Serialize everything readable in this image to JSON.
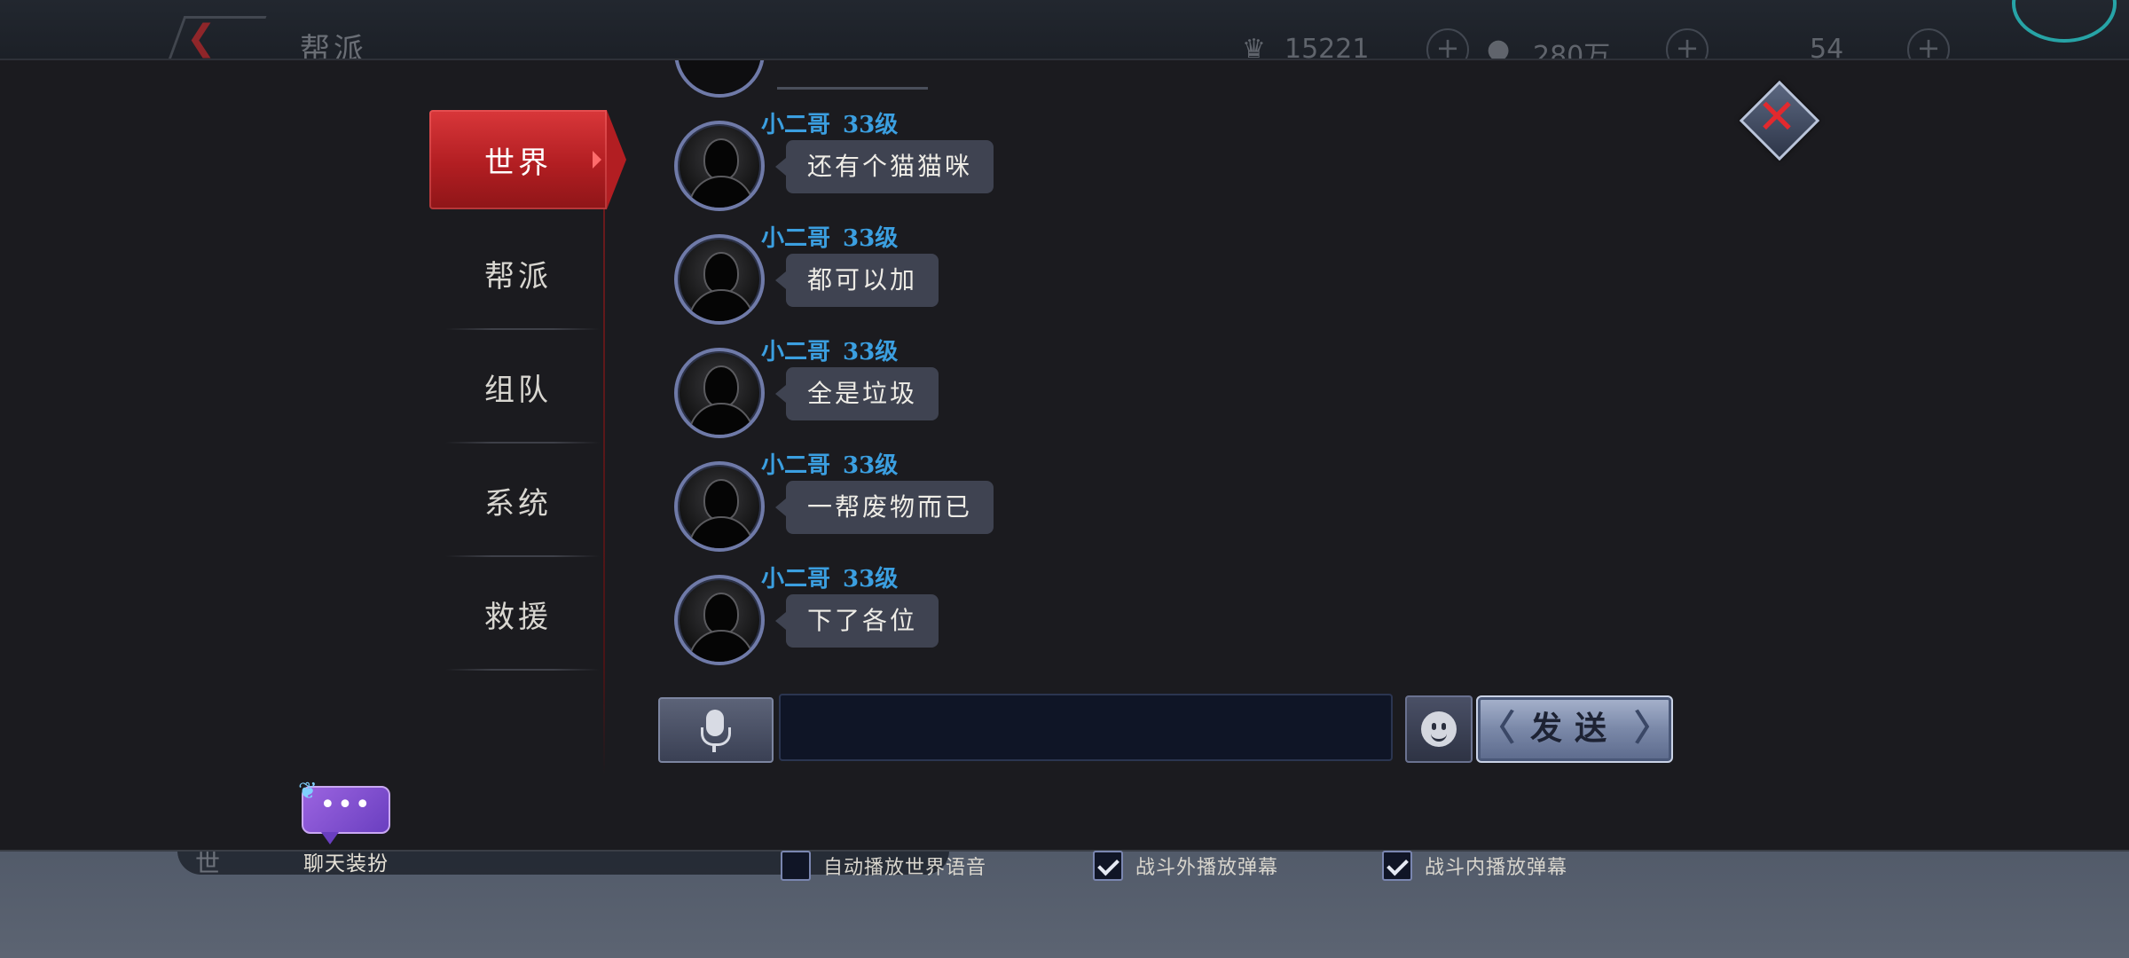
{
  "background": {
    "title": "帮派",
    "resources": [
      {
        "icon": "coin-icon",
        "value": "15221"
      },
      {
        "icon": "silver-icon",
        "value": "280万"
      },
      {
        "icon": "gem-icon",
        "value": "54"
      }
    ],
    "bottom_chat_label": "世"
  },
  "tabs": [
    {
      "label": "世界",
      "active": true
    },
    {
      "label": "帮派",
      "active": false
    },
    {
      "label": "组队",
      "active": false
    },
    {
      "label": "系统",
      "active": false
    },
    {
      "label": "救援",
      "active": false
    }
  ],
  "decoration": {
    "label": "聊天装扮",
    "bubble_text": "•••"
  },
  "messages": [
    {
      "sender": "小二哥",
      "level": "33级",
      "text": "还有个猫猫咪"
    },
    {
      "sender": "小二哥",
      "level": "33级",
      "text": "都可以加"
    },
    {
      "sender": "小二哥",
      "level": "33级",
      "text": "全是垃圾"
    },
    {
      "sender": "小二哥",
      "level": "33级",
      "text": "一帮废物而已"
    },
    {
      "sender": "小二哥",
      "level": "33级",
      "text": "下了各位"
    }
  ],
  "input": {
    "value": "",
    "placeholder": ""
  },
  "send_label": "发送",
  "options": [
    {
      "label": "自动播放世界语音",
      "checked": false
    },
    {
      "label": "战斗外播放弹幕",
      "checked": true
    },
    {
      "label": "战斗内播放弹幕",
      "checked": true
    }
  ],
  "colors": {
    "active_tab": "#b21e22",
    "sender_name": "#3b9fe0",
    "close_x": "#e2292e"
  }
}
